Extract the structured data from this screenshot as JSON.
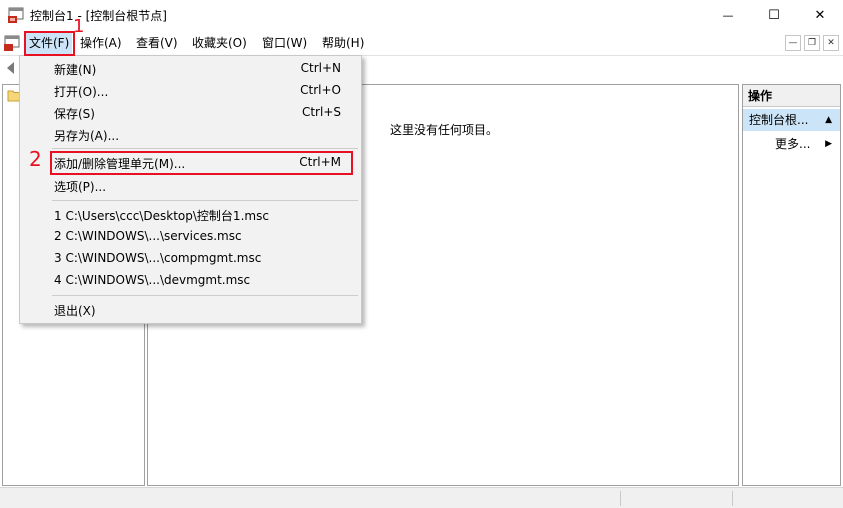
{
  "window": {
    "title": "控制台1 - [控制台根节点]",
    "minimize_glyph": "—",
    "maximize_glyph": "☐",
    "close_glyph": "✕"
  },
  "menubar": {
    "items": [
      {
        "label": "文件(F)"
      },
      {
        "label": "操作(A)"
      },
      {
        "label": "查看(V)"
      },
      {
        "label": "收藏夹(O)"
      },
      {
        "label": "窗口(W)"
      },
      {
        "label": "帮助(H)"
      }
    ],
    "mdi_minimize_glyph": "—",
    "mdi_restore_glyph": "❐",
    "mdi_close_glyph": "✕"
  },
  "file_menu": {
    "items": [
      {
        "label": "新建(N)",
        "shortcut": "Ctrl+N"
      },
      {
        "label": "打开(O)...",
        "shortcut": "Ctrl+O"
      },
      {
        "label": "保存(S)",
        "shortcut": "Ctrl+S"
      },
      {
        "label": "另存为(A)...",
        "shortcut": ""
      },
      {
        "label": "添加/删除管理单元(M)...",
        "shortcut": "Ctrl+M"
      },
      {
        "label": "选项(P)...",
        "shortcut": ""
      },
      {
        "label": "1 C:\\Users\\ccc\\Desktop\\控制台1.msc",
        "shortcut": ""
      },
      {
        "label": "2 C:\\WINDOWS\\...\\services.msc",
        "shortcut": ""
      },
      {
        "label": "3 C:\\WINDOWS\\...\\compmgmt.msc",
        "shortcut": ""
      },
      {
        "label": "4 C:\\WINDOWS\\...\\devmgmt.msc",
        "shortcut": ""
      },
      {
        "label": "退出(X)",
        "shortcut": ""
      }
    ]
  },
  "center": {
    "empty_message": "这里没有任何项目。"
  },
  "actions": {
    "header": "操作",
    "group_label": "控制台根...",
    "group_arrow": "▲",
    "more_label": "更多...",
    "more_arrow": "▶"
  },
  "annotations": {
    "step1": "1",
    "step2": "2",
    "color": "#e81123"
  },
  "colors": {
    "selection": "#cce4f7",
    "menu_bg": "#f2f2f2"
  }
}
